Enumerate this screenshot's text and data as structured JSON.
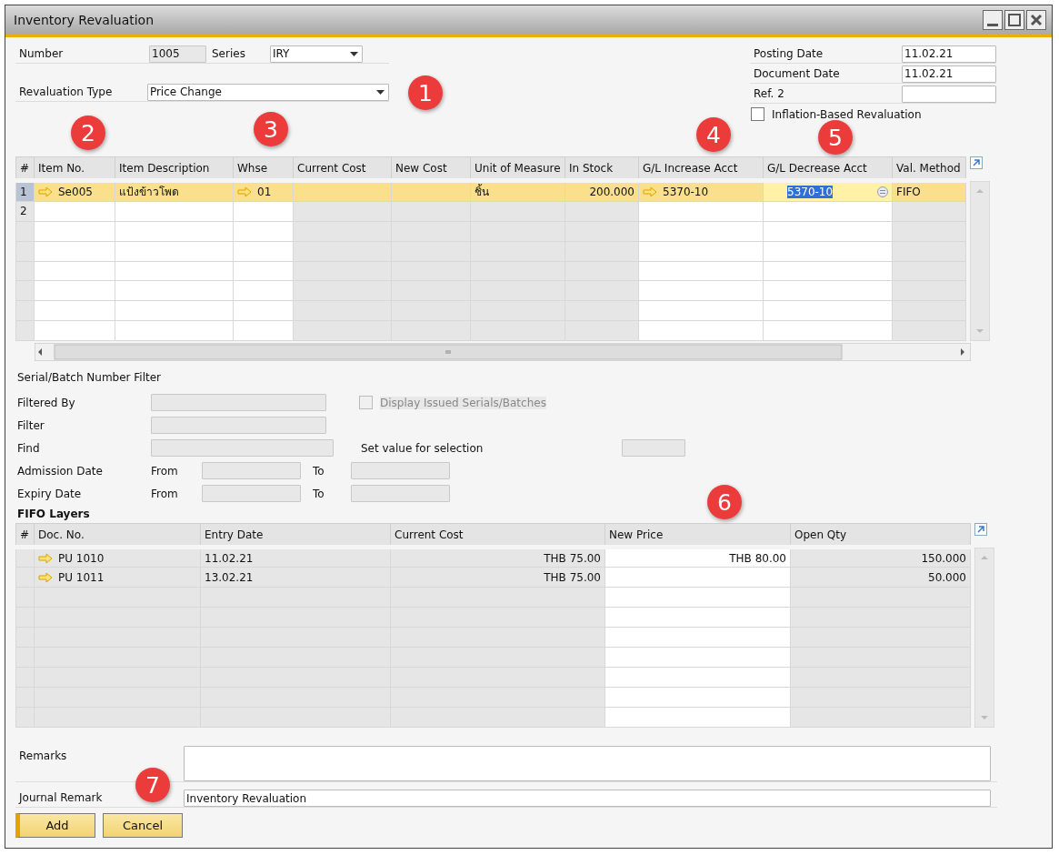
{
  "window": {
    "title": "Inventory Revaluation"
  },
  "header": {
    "number": {
      "label": "Number",
      "value": "1005"
    },
    "series": {
      "label": "Series",
      "value": "IRY"
    },
    "revaluation_type": {
      "label": "Revaluation Type",
      "value": "Price Change"
    },
    "posting_date": {
      "label": "Posting Date",
      "value": "11.02.21"
    },
    "document_date": {
      "label": "Document Date",
      "value": "11.02.21"
    },
    "ref_2": {
      "label": "Ref. 2"
    },
    "inflation_based": {
      "label": "Inflation-Based Revaluation",
      "checked": false
    }
  },
  "items": {
    "columns": [
      {
        "label": "#",
        "editable": false
      },
      {
        "label": "Item No.",
        "editable": true
      },
      {
        "label": "Item Description",
        "editable": true
      },
      {
        "label": "Whse",
        "editable": true
      },
      {
        "label": "Current Cost",
        "editable": false
      },
      {
        "label": "New Cost",
        "editable": false
      },
      {
        "label": "Unit of Measure",
        "editable": false
      },
      {
        "label": "In Stock",
        "editable": false
      },
      {
        "label": "G/L Increase Acct",
        "editable": true
      },
      {
        "label": "G/L Decrease Acct",
        "editable": true
      },
      {
        "label": "Val. Method",
        "editable": false
      }
    ],
    "rows": [
      {
        "selected": true,
        "cells": [
          {
            "text": "1"
          },
          {
            "text": "Se005",
            "link": true
          },
          {
            "text": "แป้งข้าวโพด"
          },
          {
            "text": "01",
            "link": true
          },
          {},
          {},
          {
            "text": "ชิ้น"
          },
          {
            "text": "200.000"
          },
          {
            "text": "5370-10",
            "link": true
          },
          {
            "text": "5370-10",
            "focused": true
          },
          {
            "text": "FIFO"
          }
        ]
      },
      {
        "selected": false,
        "cells": [
          {
            "text": "2"
          }
        ]
      }
    ]
  },
  "filter": {
    "title": "Serial/Batch Number Filter",
    "filtered_by": {
      "label": "Filtered By",
      "disabled": true
    },
    "display_issued": {
      "label": "Display Issued Serials/Batches",
      "checked": false,
      "disabled": true
    },
    "filter": {
      "label": "Filter",
      "disabled": true
    },
    "find": {
      "label": "Find",
      "disabled": true
    },
    "set_value": {
      "label": "Set value for selection",
      "disabled": true
    },
    "admission_date": {
      "label": "Admission Date",
      "from_label": "From",
      "to_label": "To",
      "disabled": true
    },
    "expiry_date": {
      "label": "Expiry Date",
      "from_label": "From",
      "to_label": "To",
      "disabled": true
    }
  },
  "fifo_layers": {
    "title": "FIFO Layers",
    "columns": [
      {
        "label": "#",
        "editable": false
      },
      {
        "label": "Doc. No.",
        "editable": false
      },
      {
        "label": "Entry Date",
        "editable": false
      },
      {
        "label": "Current Cost",
        "editable": false
      },
      {
        "label": "New Price",
        "editable": true
      },
      {
        "label": "Open Qty",
        "editable": false
      }
    ],
    "rows": [
      {
        "cells": [
          {},
          {
            "text": "PU 1010",
            "link": true
          },
          {
            "text": "11.02.21"
          },
          {
            "text": "THB 75.00"
          },
          {
            "text": "THB 80.00"
          },
          {
            "text": "150.000"
          }
        ]
      },
      {
        "cells": [
          {},
          {
            "text": "PU 1011",
            "link": true
          },
          {
            "text": "13.02.21"
          },
          {
            "text": "THB 75.00"
          },
          {},
          {
            "text": "50.000"
          }
        ]
      }
    ]
  },
  "remarks": {
    "label": "Remarks"
  },
  "journal_remark": {
    "label": "Journal Remark",
    "value": "Inventory Revaluation"
  },
  "buttons": [
    {
      "label": "Add",
      "default": true
    },
    {
      "label": "Cancel",
      "default": false
    }
  ],
  "callouts": [
    {
      "text": "1"
    },
    {
      "text": "2"
    },
    {
      "text": "3"
    },
    {
      "text": "4"
    },
    {
      "text": "5"
    },
    {
      "text": "6"
    },
    {
      "text": "7"
    }
  ]
}
